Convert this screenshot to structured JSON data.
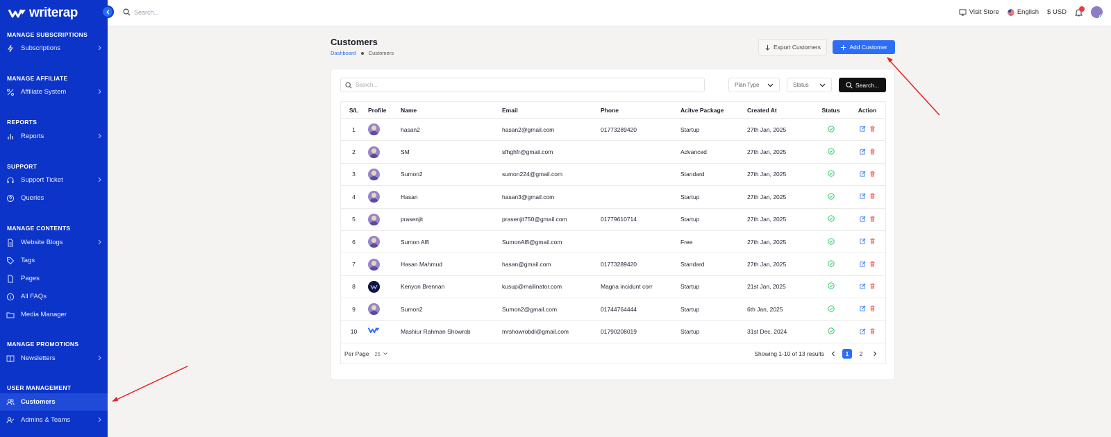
{
  "app": {
    "logo_text": "writerap"
  },
  "topbar": {
    "search_placeholder": "Search...",
    "visit_store": "Visit Store",
    "language": "English",
    "currency": "$ USD"
  },
  "sidebar": {
    "sections": [
      {
        "title": "MANAGE SUBSCRIPTIONS"
      },
      {
        "title": "MANAGE AFFILIATE"
      },
      {
        "title": "REPORTS"
      },
      {
        "title": "SUPPORT"
      },
      {
        "title": "MANAGE CONTENTS"
      },
      {
        "title": "MANAGE PROMOTIONS"
      },
      {
        "title": "USER MANAGEMENT"
      }
    ],
    "items": [
      {
        "label": "Subscriptions",
        "icon": "bolt-icon"
      },
      {
        "label": "Affiliate System",
        "icon": "percent-icon"
      },
      {
        "label": "Reports",
        "icon": "bar-chart-icon"
      },
      {
        "label": "Support Ticket",
        "icon": "headset-icon"
      },
      {
        "label": "Queries",
        "icon": "question-circle-icon"
      },
      {
        "label": "Website Blogs",
        "icon": "document-icon"
      },
      {
        "label": "Tags",
        "icon": "tag-icon"
      },
      {
        "label": "Pages",
        "icon": "page-icon"
      },
      {
        "label": "All FAQs",
        "icon": "info-circle-icon"
      },
      {
        "label": "Media Manager",
        "icon": "folder-icon"
      },
      {
        "label": "Newsletters",
        "icon": "book-icon"
      },
      {
        "label": "Customers",
        "icon": "users-icon",
        "active": true
      },
      {
        "label": "Admins & Teams",
        "icon": "user-check-icon"
      }
    ]
  },
  "page": {
    "title": "Customers",
    "breadcrumb": [
      "Dashboard",
      "Customers"
    ],
    "export_label": "Export Customers",
    "add_label": "Add Customer"
  },
  "filters": {
    "search_placeholder": "Search...",
    "plan_type": "Plan Type",
    "status": "Status",
    "search_button": "Search..."
  },
  "table": {
    "columns": [
      "S/L",
      "Profile",
      "Name",
      "Email",
      "Phone",
      "Acitve Package",
      "Created At",
      "Status",
      "Action"
    ],
    "rows": [
      {
        "sl": "1",
        "avatar": "photo",
        "name": "hasan2",
        "email": "hasan2@gmail.com",
        "phone": "01773289420",
        "package": "Startup",
        "created": "27th Jan, 2025"
      },
      {
        "sl": "2",
        "avatar": "photo",
        "name": "SM",
        "email": "sfhghfr@gmail.com",
        "phone": "",
        "package": "Advanced",
        "created": "27th Jan, 2025"
      },
      {
        "sl": "3",
        "avatar": "photo",
        "name": "Sumon2",
        "email": "sumon224@gmail.com",
        "phone": "",
        "package": "Standard",
        "created": "27th Jan, 2025"
      },
      {
        "sl": "4",
        "avatar": "photo",
        "name": "Hasan",
        "email": "hasan3@gmail.com",
        "phone": "",
        "package": "Startup",
        "created": "27th Jan, 2025"
      },
      {
        "sl": "5",
        "avatar": "photo",
        "name": "prasenjit",
        "email": "prasenjit750@gmail.com",
        "phone": "01779610714",
        "package": "Startup",
        "created": "27th Jan, 2025"
      },
      {
        "sl": "6",
        "avatar": "photo",
        "name": "Sumon Affi",
        "email": "SumonAffi@gmail.com",
        "phone": "",
        "package": "Free",
        "created": "27th Jan, 2025"
      },
      {
        "sl": "7",
        "avatar": "photo",
        "name": "Hasan Mahmud",
        "email": "hasan@gmail.com",
        "phone": "01773289420",
        "package": "Standard",
        "created": "27th Jan, 2025"
      },
      {
        "sl": "8",
        "avatar": "dark",
        "name": "Kenyon Brennan",
        "email": "kusup@mailinator.com",
        "phone": "Magna incidunt corr",
        "package": "Startup",
        "created": "21st Jan, 2025"
      },
      {
        "sl": "9",
        "avatar": "photo",
        "name": "Sumon2",
        "email": "Sumon2@gmail.com",
        "phone": "01744764444",
        "package": "Startup",
        "created": "6th Jan, 2025"
      },
      {
        "sl": "10",
        "avatar": "logo",
        "name": "Mashiur Rahman Showrob",
        "email": "mrshowrobdl@gmail.com",
        "phone": "01790208019",
        "package": "Startup",
        "created": "31st Dec, 2024"
      }
    ]
  },
  "footer": {
    "per_page_label": "Per Page",
    "per_page_value": "25",
    "showing": "Showing 1-10 of 13 results",
    "pages": [
      "1",
      "2"
    ],
    "current_page": "1"
  },
  "colors": {
    "sidebar": "#0c34c8",
    "primary": "#2d6ef5",
    "success": "#22c55e",
    "danger": "#ef4444",
    "annotation": "#e8201c"
  }
}
